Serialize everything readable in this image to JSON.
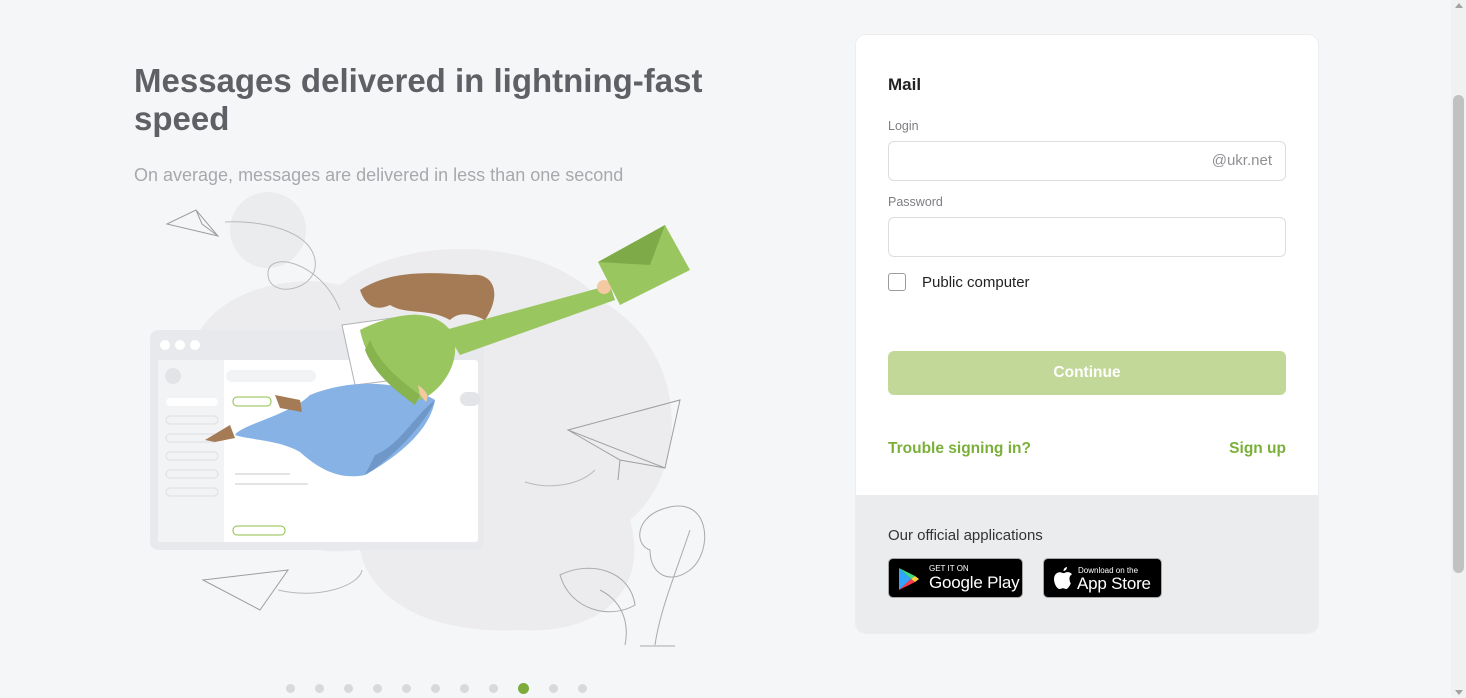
{
  "promo": {
    "title": "Messages delivered in lightning-fast speed",
    "subtitle": "On average, messages are delivered in less than one second",
    "slides_total": 11,
    "active_slide": 9
  },
  "login": {
    "heading": "Mail",
    "login_label": "Login",
    "login_value": "",
    "login_suffix": "@ukr.net",
    "password_label": "Password",
    "password_value": "",
    "public_computer_label": "Public computer",
    "public_computer_checked": false,
    "continue_label": "Continue",
    "trouble_link": "Trouble signing in?",
    "signup_link": "Sign up"
  },
  "apps": {
    "title": "Our official applications",
    "google_small": "GET IT ON",
    "google_big": "Google Play",
    "apple_small": "Download on the",
    "apple_big": "App Store"
  },
  "colors": {
    "accent_green": "#7ab03a",
    "button_disabled": "#c2d899",
    "page_bg": "#f5f6f8"
  }
}
